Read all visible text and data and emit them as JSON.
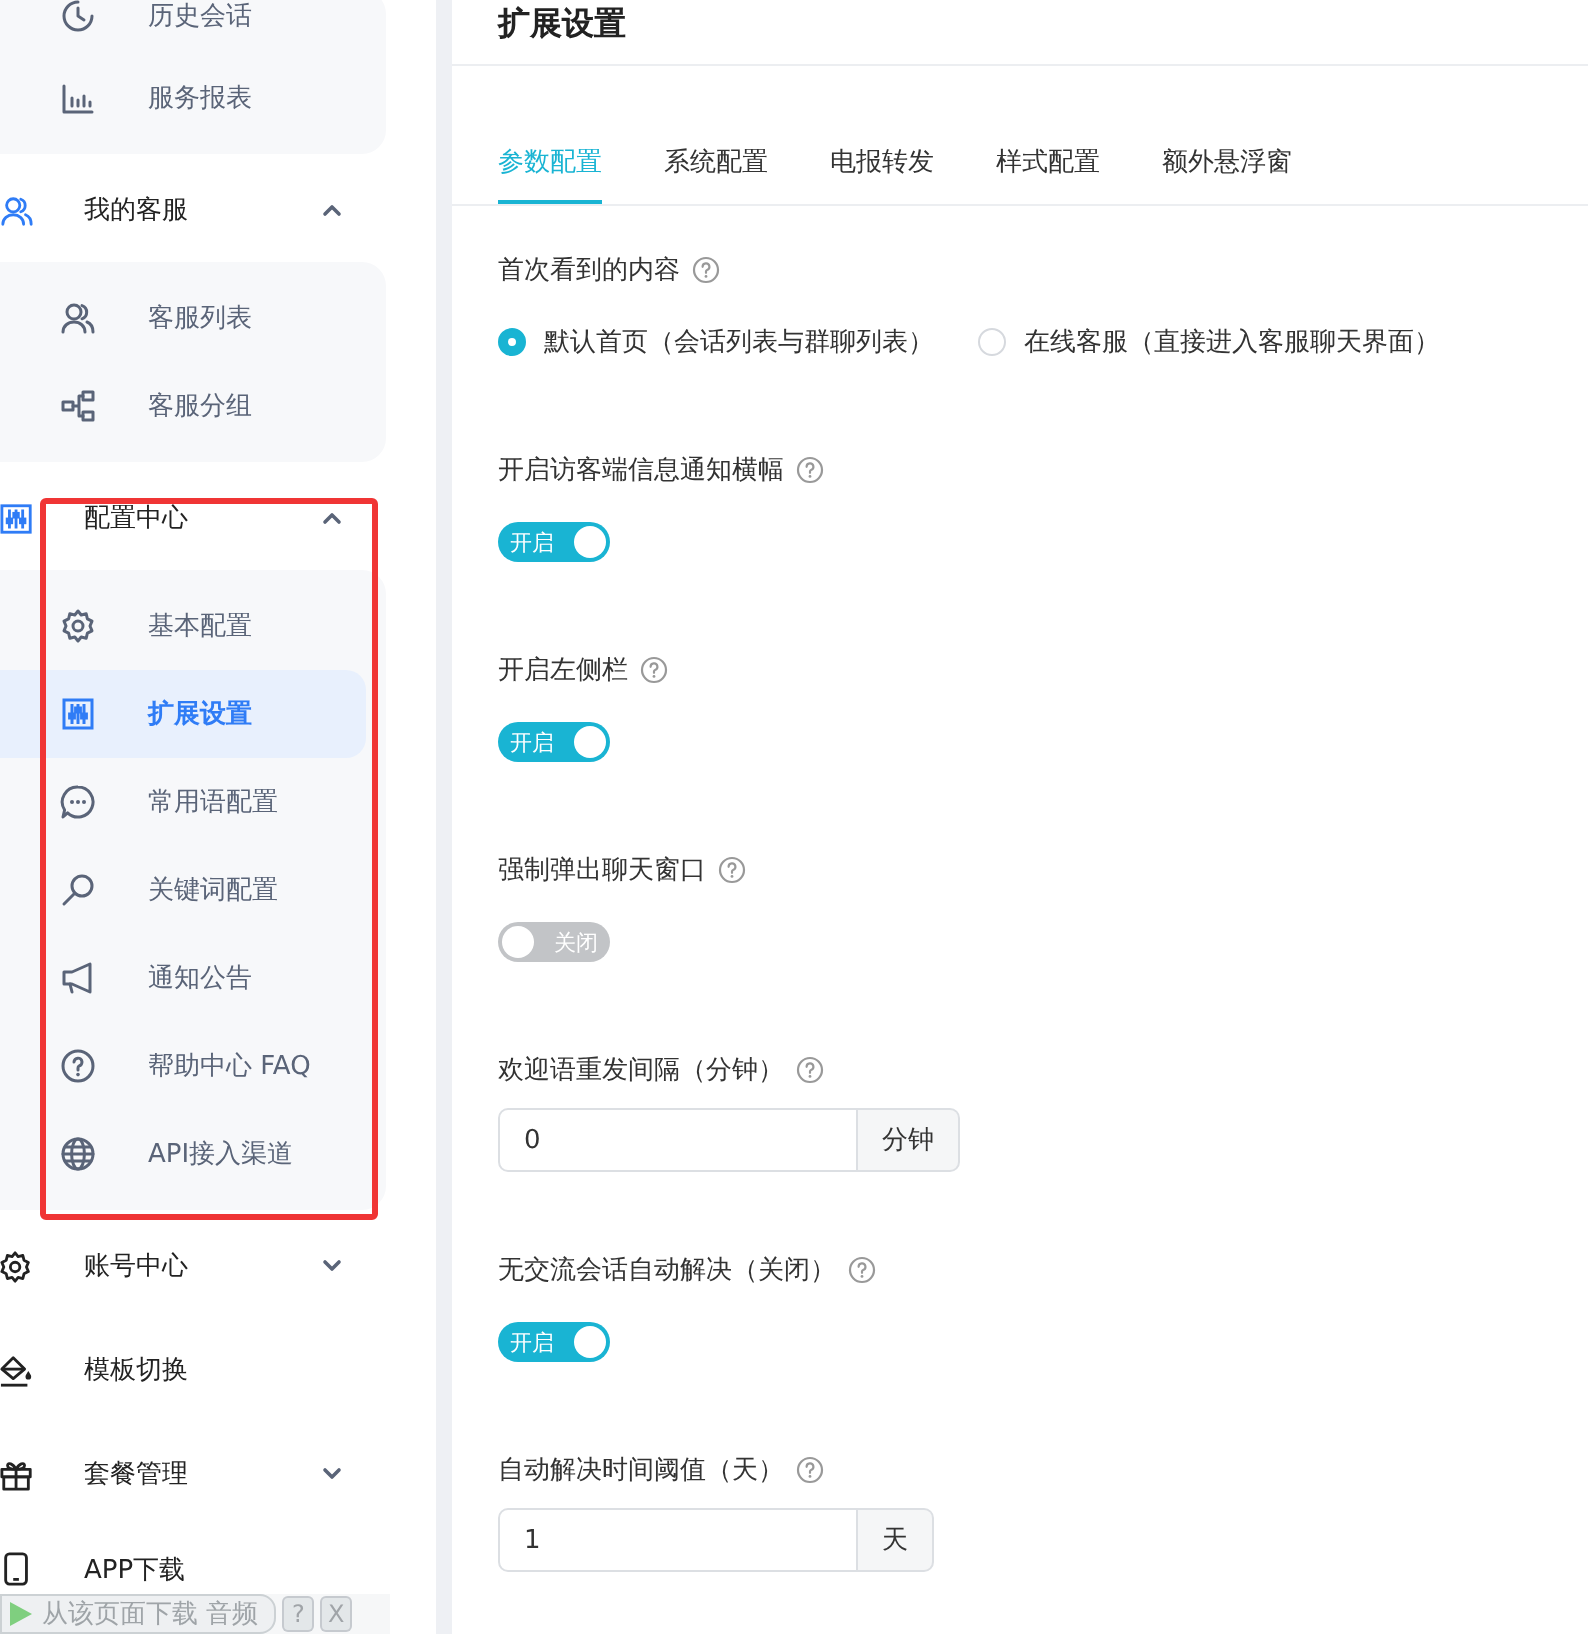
{
  "sidebar": {
    "entries": [
      {
        "kind": "panel",
        "items": [
          {
            "label": "历史会话",
            "selected": false
          },
          {
            "label": "服务报表",
            "selected": false
          }
        ]
      },
      {
        "kind": "group",
        "label": "我的客服",
        "expanded": true
      },
      {
        "kind": "panel",
        "items": [
          {
            "label": "客服列表",
            "selected": false
          },
          {
            "label": "客服分组",
            "selected": false
          }
        ]
      },
      {
        "kind": "group",
        "label": "配置中心",
        "expanded": true
      },
      {
        "kind": "panel",
        "items": [
          {
            "label": "基本配置",
            "selected": false
          },
          {
            "label": "扩展设置",
            "selected": true
          },
          {
            "label": "常用语配置",
            "selected": false
          },
          {
            "label": "关键词配置",
            "selected": false
          },
          {
            "label": "通知公告",
            "selected": false
          },
          {
            "label": "帮助中心 FAQ",
            "selected": false
          },
          {
            "label": "API接入渠道",
            "selected": false
          }
        ]
      },
      {
        "kind": "group",
        "label": "账号中心",
        "expanded": false
      },
      {
        "kind": "link",
        "label": "模板切换"
      },
      {
        "kind": "group",
        "label": "套餐管理",
        "expanded": false
      },
      {
        "kind": "link",
        "label": "APP下载"
      }
    ]
  },
  "main": {
    "title": "扩展设置",
    "tabs": [
      {
        "label": "参数配置",
        "selected": true
      },
      {
        "label": "系统配置",
        "selected": false
      },
      {
        "label": "电报转发",
        "selected": false
      },
      {
        "label": "样式配置",
        "selected": false
      },
      {
        "label": "额外悬浮窗",
        "selected": false
      }
    ],
    "fields": [
      {
        "kind": "radio",
        "label": "首次看到的内容",
        "options": [
          {
            "label": "默认首页（会话列表与群聊列表）",
            "selected": true
          },
          {
            "label": "在线客服（直接进入客服聊天界面）",
            "selected": false
          }
        ]
      },
      {
        "kind": "switch",
        "label": "开启访客端信息通知横幅",
        "on": true,
        "text": "开启"
      },
      {
        "kind": "switch",
        "label": "开启左侧栏",
        "on": true,
        "text": "开启"
      },
      {
        "kind": "switch",
        "label": "强制弹出聊天窗口",
        "on": false,
        "text": "关闭"
      },
      {
        "kind": "number",
        "label": "欢迎语重发间隔（分钟）",
        "value": "0",
        "unit": "分钟"
      },
      {
        "kind": "switch",
        "label": "无交流会话自动解决（关闭）",
        "on": true,
        "text": "开启"
      },
      {
        "kind": "number",
        "label": "自动解决时间阈值（天）",
        "value": "1",
        "unit": "天"
      }
    ]
  },
  "download_bar": {
    "text": "从该页面下载 音频",
    "help": "?",
    "close": "X"
  }
}
